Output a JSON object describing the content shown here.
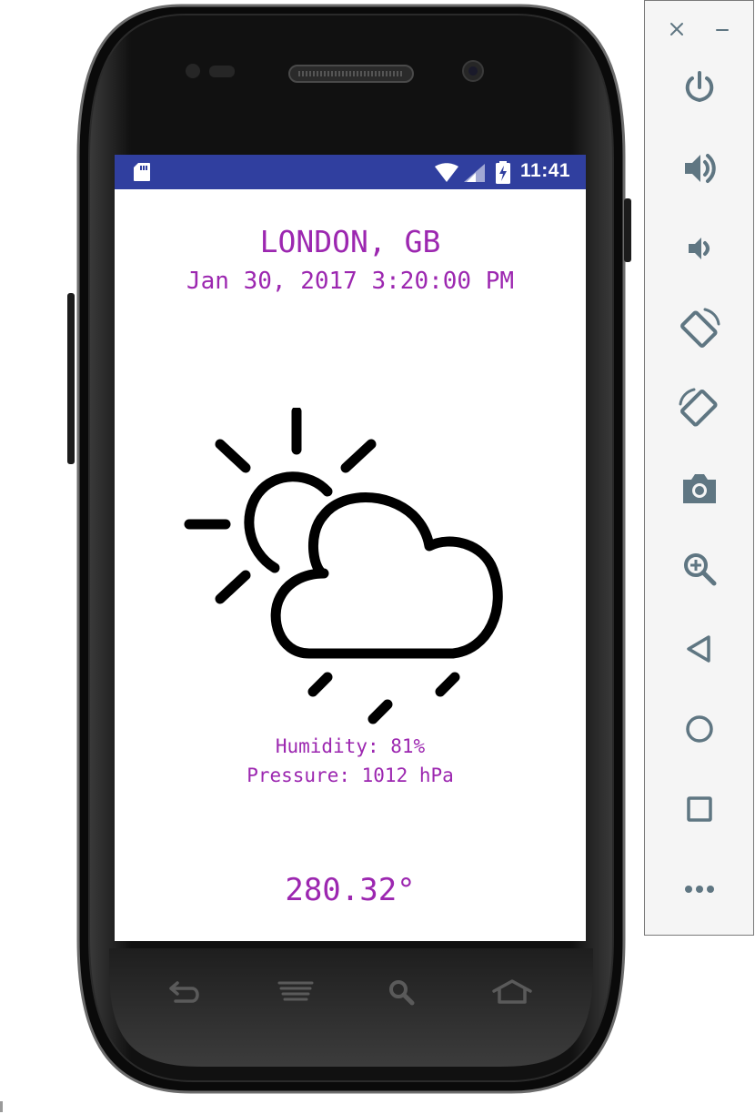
{
  "status_bar": {
    "time": "11:41",
    "icons": [
      "sd-card-icon",
      "wifi-icon",
      "signal-icon",
      "battery-charging-icon"
    ],
    "background_color": "#303f9f"
  },
  "weather": {
    "location": "LONDON, GB",
    "datetime": "Jan 30, 2017 3:20:00 PM",
    "condition_icon": "partly-cloudy-rain-icon",
    "humidity": "Humidity: 81%",
    "pressure": "Pressure: 1012 hPa",
    "temperature": "280.32°",
    "text_color": "#9c27b0"
  },
  "hardware_keys": [
    "back-key",
    "menu-key",
    "search-key",
    "home-key"
  ],
  "emulator_toolbar": {
    "window_controls": [
      "close-icon",
      "minimize-icon"
    ],
    "buttons": [
      "power-icon",
      "volume-up-icon",
      "volume-down-icon",
      "rotate-left-icon",
      "rotate-right-icon",
      "camera-icon",
      "zoom-icon",
      "back-icon",
      "home-icon",
      "overview-icon",
      "more-icon"
    ],
    "icon_color": "#5f7682"
  }
}
